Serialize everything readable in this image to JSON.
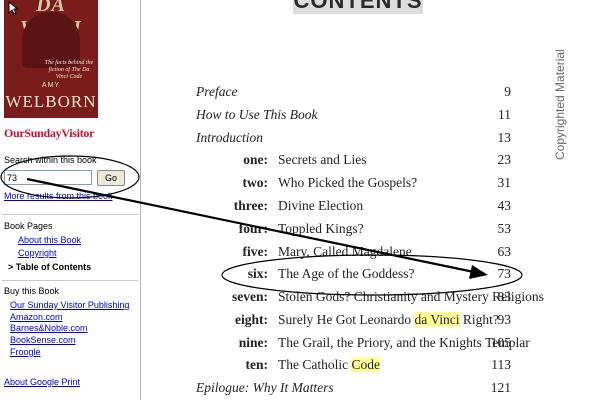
{
  "book": {
    "cover": {
      "title_text": "DA VINCI",
      "tagline": "The facts behind the fiction of The Da Vinci Code",
      "author_first": "AMY",
      "author_last": "WELBORN"
    },
    "publisher": "OurSundayVisitor"
  },
  "search": {
    "label": "Search within this book",
    "value": "73",
    "button": "Go",
    "more_results": "More results from this book"
  },
  "book_pages": {
    "title": "Book Pages",
    "items": [
      {
        "label": "About this Book"
      },
      {
        "label": "Copyright"
      },
      {
        "label": "> Table of Contents"
      }
    ]
  },
  "buy": {
    "title": "Buy this Book",
    "links": [
      {
        "label": "Our Sunday Visitor Publishing"
      },
      {
        "label": "Amazon.com"
      },
      {
        "label": "Barnes&Noble.com"
      },
      {
        "label": "BookSense.com"
      },
      {
        "label": "Froogle"
      }
    ]
  },
  "about_google_print": "About Google Print",
  "toc": {
    "heading": "CONTENTS",
    "front": [
      {
        "title": "Preface",
        "page": "9"
      },
      {
        "title": "How to Use This Book",
        "page": "11"
      },
      {
        "title": "Introduction",
        "page": "13"
      }
    ],
    "chapters": [
      {
        "label": "one:",
        "title": "Secrets and Lies",
        "page": "23"
      },
      {
        "label": "two:",
        "title": "Who Picked the Gospels?",
        "page": "31"
      },
      {
        "label": "three:",
        "title": "Divine Election",
        "page": "43"
      },
      {
        "label": "four:",
        "title": "Toppled Kings?",
        "page": "53"
      },
      {
        "label": "five:",
        "title": "Mary, Called Magdalene",
        "page": "63"
      },
      {
        "label": "six:",
        "title": "The Age of the Goddess?",
        "page": "73"
      },
      {
        "label": "seven:",
        "title": "Stolen Gods? Christianity and Mystery Religions",
        "page": "83"
      },
      {
        "label": "eight:",
        "title_before": "Surely He Got Leonardo ",
        "title_highlight": "da Vinci",
        "title_after": " Right?",
        "page": "93"
      },
      {
        "label": "nine:",
        "title": "The Grail, the Priory, and the Knights Templar",
        "page": "105"
      },
      {
        "label": "ten:",
        "title_before": "The Catholic ",
        "title_highlight": "Code",
        "page": "113"
      }
    ],
    "back": [
      {
        "title": "Epilogue: Why It Matters",
        "page": "121"
      }
    ]
  },
  "watermark": "Copyrighted Material",
  "colors": {
    "link": "#0000cc",
    "publisher_red": "#c8102e",
    "cover_red": "#7a1c1c",
    "highlight": "#ffff99",
    "annotation": "#000000"
  }
}
